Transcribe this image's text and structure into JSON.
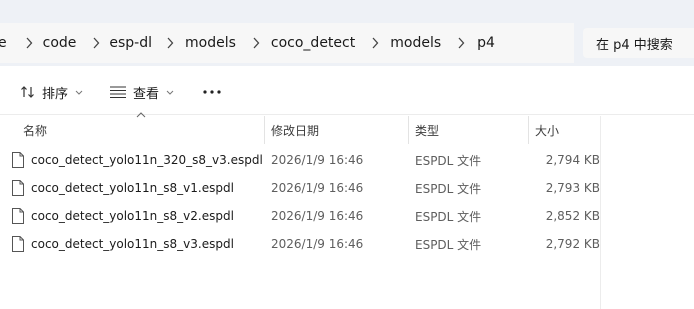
{
  "breadcrumb": {
    "items": [
      "e",
      "code",
      "esp-dl",
      "models",
      "coco_detect",
      "models",
      "p4"
    ]
  },
  "search": {
    "placeholder": "在 p4 中搜索"
  },
  "commandbar": {
    "sort_label": "排序",
    "view_label": "查看",
    "more_label": "···"
  },
  "columns": {
    "name": "名称",
    "date": "修改日期",
    "type": "类型",
    "size": "大小"
  },
  "files": [
    {
      "name": "coco_detect_yolo11n_320_s8_v3.espdl",
      "date": "2026/1/9 16:46",
      "type": "ESPDL 文件",
      "size": "2,794 KB"
    },
    {
      "name": "coco_detect_yolo11n_s8_v1.espdl",
      "date": "2026/1/9 16:46",
      "type": "ESPDL 文件",
      "size": "2,793 KB"
    },
    {
      "name": "coco_detect_yolo11n_s8_v2.espdl",
      "date": "2026/1/9 16:46",
      "type": "ESPDL 文件",
      "size": "2,852 KB"
    },
    {
      "name": "coco_detect_yolo11n_s8_v3.espdl",
      "date": "2026/1/9 16:46",
      "type": "ESPDL 文件",
      "size": "2,792 KB"
    }
  ],
  "colors": {
    "topband": "#eef1f6",
    "addressbar": "#f7f7f7",
    "divider": "#e3e3e3"
  },
  "icons": {
    "breadcrumb_separator": "chevron-right-icon",
    "sort": "sort-icon",
    "view": "view-list-icon",
    "file": "file-icon"
  }
}
